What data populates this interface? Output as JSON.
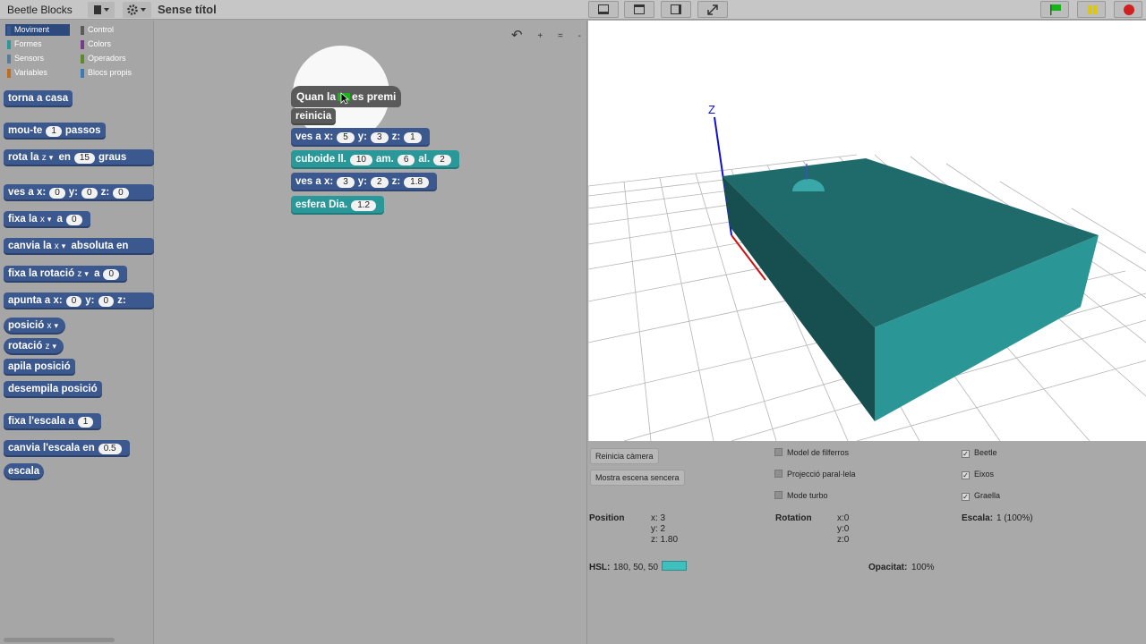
{
  "app": {
    "title": "Beetle Blocks",
    "project_title": "Sense títol"
  },
  "toolbar": {
    "file_icon": "file-icon",
    "settings_icon": "gear-icon",
    "stage_buttons": [
      "layout-normal-icon",
      "layout-small-icon",
      "layout-hide-icon",
      "fullscreen-icon"
    ],
    "run": {
      "flag_color": "#19b319",
      "pause_color": "#e0c800",
      "stop_color": "#d02020"
    }
  },
  "categories": [
    {
      "label": "Moviment",
      "color": "#3c598f",
      "selected": true
    },
    {
      "label": "Control",
      "color": "#5a5a5a"
    },
    {
      "label": "Formes",
      "color": "#2a9898"
    },
    {
      "label": "Colors",
      "color": "#7a3a8a"
    },
    {
      "label": "Sensors",
      "color": "#5a7a9a"
    },
    {
      "label": "Operadors",
      "color": "#5d8b2a"
    },
    {
      "label": "Variables",
      "color": "#c26a1e"
    },
    {
      "label": "Blocs propis",
      "color": "#3a7ab8"
    }
  ],
  "palette": {
    "torna": "torna a casa",
    "mou_a": "mou-te",
    "mou_v": "1",
    "mou_b": "passos",
    "rota_a": "rota la",
    "rota_axis": "z",
    "rota_b": "en",
    "rota_v": "15",
    "rota_c": "graus",
    "ves_a": "ves a x:",
    "ves_x": "0",
    "ves_y_l": "y:",
    "ves_y": "0",
    "ves_z_l": "z:",
    "ves_z": "0",
    "fixa_a": "fixa la",
    "fixa_axis": "x",
    "fixa_b": "a",
    "fixa_v": "0",
    "canvia_a": "canvia la",
    "canvia_axis": "x",
    "canvia_b": "absoluta en",
    "fixrot_a": "fixa la rotació",
    "fixrot_axis": "z",
    "fixrot_b": "a",
    "fixrot_v": "0",
    "apunta_a": "apunta a x:",
    "apunta_x": "0",
    "apunta_y_l": "y:",
    "apunta_y": "0",
    "apunta_z_l": "z:",
    "posicio": "posició",
    "posicio_axis": "x",
    "rotacio": "rotació",
    "rotacio_axis": "z",
    "apila": "apila posició",
    "desempila": "desempila posició",
    "fixesc_a": "fixa l'escala a",
    "fixesc_v": "1",
    "canvesc_a": "canvia l'escala en",
    "canvesc_v": "0.5",
    "escala": "escala"
  },
  "script": {
    "hat_a": "Quan la",
    "hat_b": "es premi",
    "reinicia": "reinicia",
    "b1_a": "ves a x:",
    "b1_x": "5",
    "b1_yl": "y:",
    "b1_y": "3",
    "b1_zl": "z:",
    "b1_z": "1",
    "b2_a": "cuboide ll.",
    "b2_v1": "10",
    "b2_b": "am.",
    "b2_v2": "6",
    "b2_c": "al.",
    "b2_v3": "2",
    "b3_a": "ves a x:",
    "b3_x": "3",
    "b3_yl": "y:",
    "b3_y": "2",
    "b3_zl": "z:",
    "b3_z": "1.8",
    "b4_a": "esfera Dia.",
    "b4_v": "1.2",
    "undo_icon": "undo-icon",
    "zoom_icons": [
      "+",
      "=",
      "-"
    ]
  },
  "stage": {
    "axis_label_z": "Z",
    "cuboid_color": "#1f7f7f",
    "sphere_color": "#3aa8a8"
  },
  "controls": {
    "reset_camera": "Reinicia càmera",
    "show_scene": "Mostra escena sencera",
    "wireframe": "Model de filferros",
    "parallel": "Projecció paral·lela",
    "turbo": "Mode turbo",
    "beetle": "Beetle",
    "axes": "Eixos",
    "grid": "Graella",
    "position_label": "Position",
    "pos_x": "x: 3",
    "pos_y": "y: 2",
    "pos_z": "z: 1.80",
    "rotation_label": "Rotation",
    "rot_x": "x:0",
    "rot_y": "y:0",
    "rot_z": "z:0",
    "scale_label": "Escala:",
    "scale_value": "1 (100%)",
    "hsl_label": "HSL:",
    "hsl_value": "180, 50, 50",
    "opacity_label": "Opacitat:",
    "opacity_value": "100%"
  }
}
